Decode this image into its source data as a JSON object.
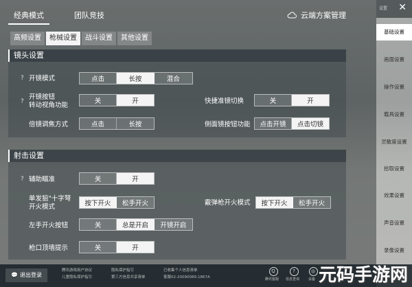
{
  "main_tabs": [
    {
      "label": "经典模式",
      "active": true
    },
    {
      "label": "团队竞技",
      "active": false
    }
  ],
  "cloud": {
    "label": "云端方案管理"
  },
  "sub_tabs": [
    {
      "label": "高频设置",
      "active": false
    },
    {
      "label": "枪械设置",
      "active": true
    },
    {
      "label": "战斗设置",
      "active": false
    },
    {
      "label": "其他设置",
      "active": false
    }
  ],
  "scope": {
    "title": "镜头设置",
    "scope_mode": {
      "label": "开镜模式",
      "options": [
        "点击",
        "长按",
        "混合"
      ],
      "selected": 1
    },
    "scope_button": {
      "label_1": "开镜按钮",
      "label_2": "转动视角功能",
      "options": [
        "关",
        "开"
      ],
      "selected": 1
    },
    "quick_switch": {
      "label": "快捷准镜切换",
      "options": [
        "关",
        "开"
      ],
      "selected": 1
    },
    "zoom": {
      "label": "倍镜调焦方式",
      "options": [
        "点击",
        "长按"
      ],
      "selected": -1
    },
    "side_scope": {
      "label": "侧面镜按钮功能",
      "options": [
        "点击开镜",
        "点击切镜"
      ],
      "selected": 1
    }
  },
  "shoot": {
    "title": "射击设置",
    "aim_assist": {
      "label": "辅助瞄准",
      "options": [
        "关",
        "开"
      ],
      "selected": 1
    },
    "single_shot": {
      "label_1": "单发狙\"十字弩",
      "label_2": "开火模式",
      "options": [
        "按下开火",
        "松手开火"
      ],
      "selected": 0
    },
    "shotgun": {
      "label": "霰弹枪开火模式",
      "options": [
        "按下开火",
        "松手开火"
      ],
      "selected": 0
    },
    "left_fire": {
      "label": "左手开火按钮",
      "options": [
        "关",
        "总是开启",
        "开镜开启"
      ],
      "selected": 1
    },
    "muzzle": {
      "label": "枪口顶墙提示",
      "options": [
        "关",
        "开"
      ],
      "selected": 1
    }
  },
  "topctl": {
    "label": "设置",
    "close": "✕"
  },
  "sidebar": [
    {
      "label": "基础设置",
      "active": true
    },
    {
      "label": "画面设置"
    },
    {
      "label": "操作设置"
    },
    {
      "label": "载具设置"
    },
    {
      "label": "灵敏度设置"
    },
    {
      "label": "拾取设置"
    },
    {
      "label": "效果设置"
    },
    {
      "label": "声音设置"
    },
    {
      "label": "录像设置"
    }
  ],
  "bottom": {
    "logout": "退出登录",
    "links": [
      "腾讯游戏用户协议",
      "隐私保护指引",
      "已收集个人信息清单",
      "儿童隐私保护指引",
      "第三方信息共享清单",
      "客服02-20090089-1867A"
    ],
    "icons": [
      {
        "glyph": "Q",
        "label": "腾讯客服"
      },
      {
        "glyph": "?",
        "label": "信息查询"
      },
      {
        "glyph": "◎",
        "label": "设备"
      }
    ]
  },
  "watermark": {
    "text": "元码手游网",
    "sq": "网"
  }
}
